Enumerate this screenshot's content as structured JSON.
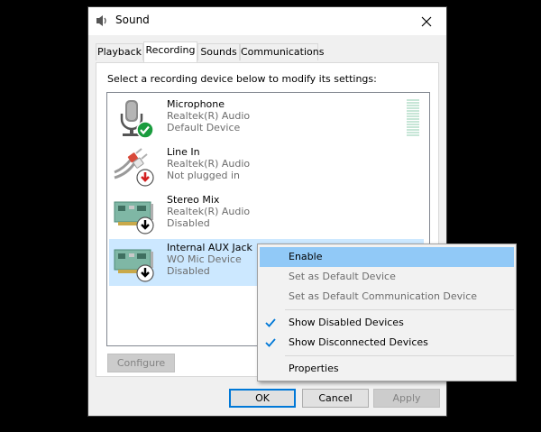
{
  "window": {
    "title": "Sound",
    "close_icon": "close-icon"
  },
  "tabs": [
    {
      "label": "Playback",
      "active": false
    },
    {
      "label": "Recording",
      "active": true
    },
    {
      "label": "Sounds",
      "active": false
    },
    {
      "label": "Communications",
      "active": false
    }
  ],
  "instructions": "Select a recording device below to modify its settings:",
  "devices": [
    {
      "name": "Microphone",
      "driver": "Realtek(R) Audio",
      "status": "Default Device",
      "icon": "microphone-icon",
      "badge": "check-badge-icon",
      "badge_color": "#1a9c3e"
    },
    {
      "name": "Line In",
      "driver": "Realtek(R) Audio",
      "status": "Not plugged in",
      "icon": "line-in-jack-icon",
      "badge": "down-arrow-red-badge-icon",
      "badge_color": "#d32020"
    },
    {
      "name": "Stereo Mix",
      "driver": "Realtek(R) Audio",
      "status": "Disabled",
      "icon": "sound-card-icon",
      "badge": "down-arrow-badge-icon",
      "badge_color": "#000000"
    },
    {
      "name": "Internal AUX Jack",
      "driver": "WO Mic Device",
      "status": "Disabled",
      "icon": "sound-card-icon",
      "badge": "down-arrow-badge-icon",
      "badge_color": "#000000"
    }
  ],
  "buttons": {
    "configure": "Configure",
    "ok": "OK",
    "cancel": "Cancel",
    "apply": "Apply"
  },
  "context_menu": {
    "items": [
      {
        "label": "Enable",
        "state": "highlighted"
      },
      {
        "label": "Set as Default Device",
        "state": "disabled"
      },
      {
        "label": "Set as Default Communication Device",
        "state": "disabled"
      },
      {
        "label": "Show Disabled Devices",
        "state": "checked"
      },
      {
        "label": "Show Disconnected Devices",
        "state": "checked"
      },
      {
        "label": "Properties",
        "state": "normal"
      }
    ]
  },
  "colors": {
    "selection": "#cce8ff",
    "menu_highlight": "#91c9f7",
    "check_color": "#0078d7",
    "level_meter": "#c7e6d7"
  }
}
